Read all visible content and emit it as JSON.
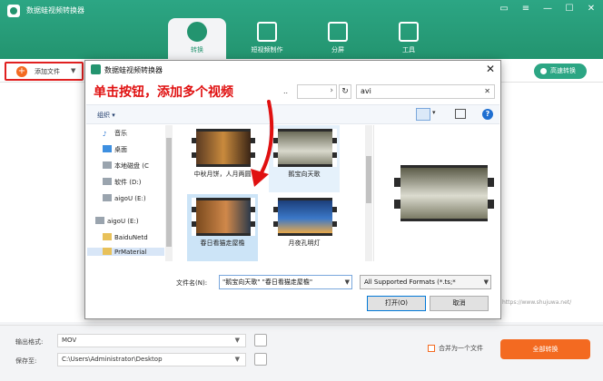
{
  "app": {
    "title": "数据蛙视频转换器",
    "nav": [
      {
        "label": "转换"
      },
      {
        "label": "短视频制作"
      },
      {
        "label": "分屏"
      },
      {
        "label": "工具"
      }
    ],
    "window_controls": [
      "▭",
      "≡",
      "—",
      "☐",
      "✕"
    ]
  },
  "toolbar": {
    "add_file_label": "添加文件",
    "merge_button_label": "高速转换"
  },
  "watermark": "https://www.shujuwa.net/",
  "bottom": {
    "output_format_label": "输出格式:",
    "output_format_value": "MOV",
    "save_to_label": "保存至:",
    "save_to_value": "C:\\Users\\Administrator\\Desktop",
    "merge_label": "合并为一个文件",
    "convert_all_label": "全部转换"
  },
  "dialog": {
    "title": "数据蛙视频转换器",
    "annotation": "单击按钮，添加多个视频",
    "address_dots": "..",
    "search_value": "avi",
    "organize_label": "组织",
    "nav_items": [
      {
        "label": "音乐",
        "icon": "music-icon"
      },
      {
        "label": "桌面",
        "icon": "desktop-icon"
      },
      {
        "label": "本地磁盘 (C",
        "icon": "drive-icon"
      },
      {
        "label": "软件 (D:)",
        "icon": "drive-icon"
      },
      {
        "label": "aigoU (E:)",
        "icon": "drive-icon"
      },
      {
        "label": "aigoU (E:)",
        "icon": "usb-drive-icon"
      },
      {
        "label": "BaiduNetd",
        "icon": "folder-icon"
      },
      {
        "label": "PrMaterial",
        "icon": "folder-icon"
      }
    ],
    "files": [
      {
        "name": "中秋月饼，人月两圆"
      },
      {
        "name": "鹅宝向天歌"
      },
      {
        "name": "春日看猫走屋檐"
      },
      {
        "name": "月夜孔明灯"
      }
    ],
    "file_name_label": "文件名(N):",
    "file_name_value": "\"鹅宝向天歌\" \"春日看猫走屋檐\"",
    "format_value": "All Supported Formats (*.ts;*",
    "open_label": "打开(O)",
    "cancel_label": "取消"
  },
  "colors": {
    "brand_green": "#23946f",
    "accent_orange": "#f36a21",
    "annotation_red": "#e01010"
  }
}
